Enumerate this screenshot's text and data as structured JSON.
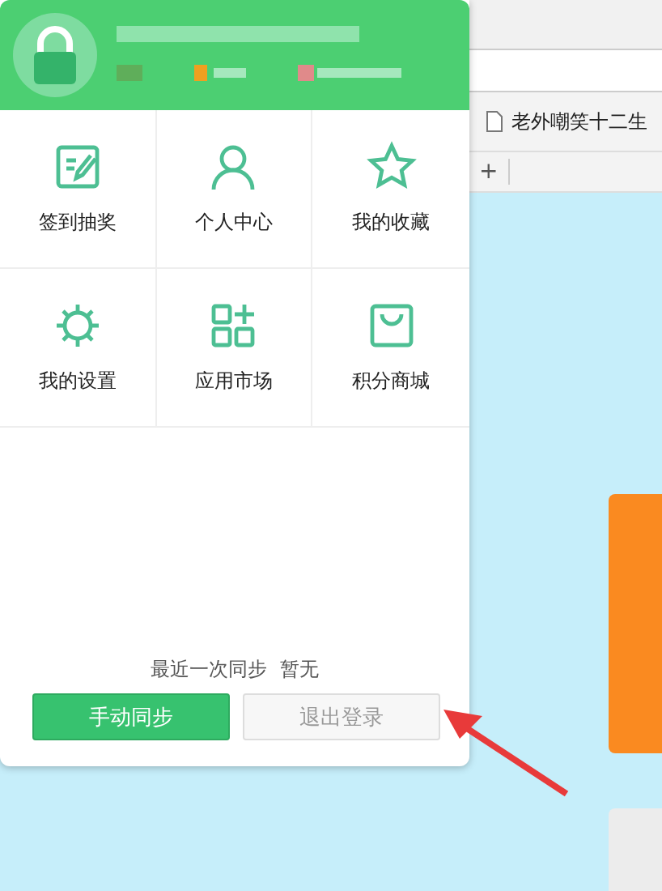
{
  "menu": {
    "items": [
      {
        "label": "签到抽奖",
        "kind": "sign"
      },
      {
        "label": "个人中心",
        "kind": "person"
      },
      {
        "label": "我的收藏",
        "kind": "star"
      },
      {
        "label": "我的设置",
        "kind": "gear"
      },
      {
        "label": "应用市场",
        "kind": "apps"
      },
      {
        "label": "积分商城",
        "kind": "bag"
      }
    ],
    "sync_status": "最近一次同步  暂无",
    "buttons": [
      {
        "label": "手动同步",
        "kind": "primary"
      },
      {
        "label": "退出登录",
        "kind": "secondary"
      }
    ]
  },
  "browser": {
    "bookmark": "老外嘲笑十二生",
    "new_tab": "+"
  }
}
